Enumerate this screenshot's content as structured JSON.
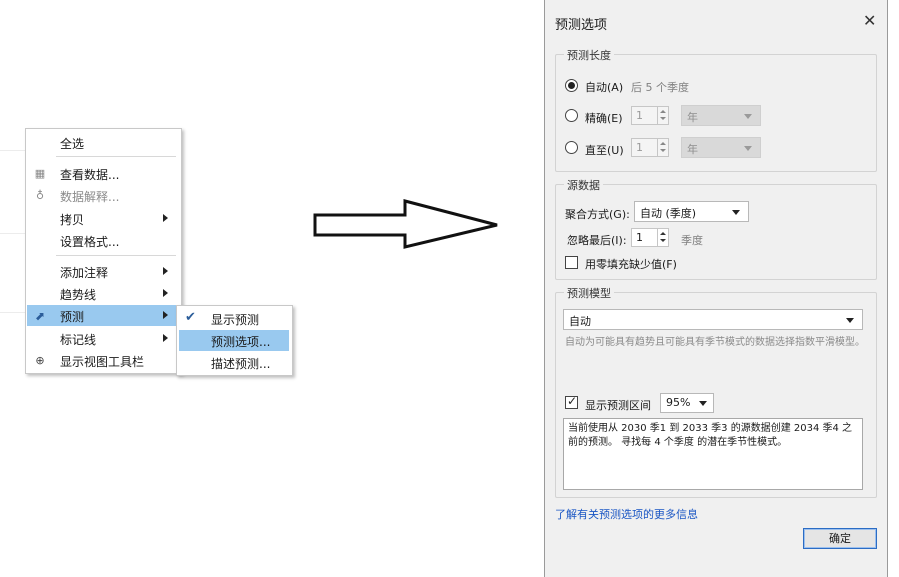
{
  "context_menu": {
    "items": [
      {
        "label": "全选"
      },
      {
        "label": "查看数据..."
      },
      {
        "label": "数据解释..."
      },
      {
        "label": "拷贝"
      },
      {
        "label": "设置格式..."
      },
      {
        "label": "添加注释"
      },
      {
        "label": "趋势线"
      },
      {
        "label": "预测"
      },
      {
        "label": "标记线"
      },
      {
        "label": "显示视图工具栏"
      }
    ]
  },
  "submenu": {
    "items": [
      {
        "label": "显示预测"
      },
      {
        "label": "预测选项..."
      },
      {
        "label": "描述预测..."
      }
    ]
  },
  "dialog": {
    "title": "预测选项",
    "close_glyph": "✕",
    "forecast_length": {
      "title": "预测长度",
      "auto_label": "自动(A)",
      "auto_hint": "后 5 个季度",
      "exact_label": "精确(E)",
      "exact_value": "1",
      "exact_unit": "年",
      "until_label": "直至(U)",
      "until_value": "1",
      "until_unit": "年"
    },
    "source_data": {
      "title": "源数据",
      "aggregate_label": "聚合方式(G):",
      "aggregate_value": "自动 (季度)",
      "ignore_label": "忽略最后(I):",
      "ignore_value": "1",
      "ignore_unit": "季度",
      "fill_zero_label": "用零填充缺少值(F)"
    },
    "forecast_model": {
      "title": "预测模型",
      "model_value": "自动",
      "description": "自动为可能具有趋势且可能具有季节模式的数据选择指数平滑模型。",
      "show_interval_label": "显示预测区间",
      "interval_value": "95%",
      "summary": "当前使用从 2030 季1 到 2033 季3 的源数据创建 2034 季4 之前的预测。 寻找每 4 个季度 的潜在季节性模式。"
    },
    "learn_more_link": "了解有关预测选项的更多信息",
    "ok_label": "确定"
  }
}
